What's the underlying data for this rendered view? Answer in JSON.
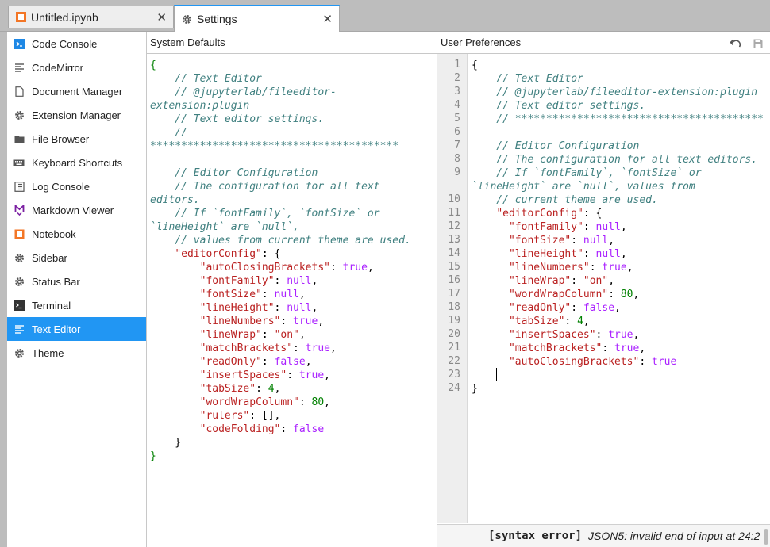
{
  "tabs": [
    {
      "label": "Untitled.ipynb",
      "icon": "notebook-icon",
      "active": false
    },
    {
      "label": "Settings",
      "icon": "gear-icon",
      "active": true
    }
  ],
  "close_glyph": "✕",
  "sidebar": {
    "items": [
      {
        "label": "Code Console",
        "icon": "console-icon"
      },
      {
        "label": "CodeMirror",
        "icon": "text-lines-icon"
      },
      {
        "label": "Document Manager",
        "icon": "document-icon"
      },
      {
        "label": "Extension Manager",
        "icon": "gear-icon"
      },
      {
        "label": "File Browser",
        "icon": "folder-icon"
      },
      {
        "label": "Keyboard Shortcuts",
        "icon": "keyboard-icon"
      },
      {
        "label": "Log Console",
        "icon": "list-icon"
      },
      {
        "label": "Markdown Viewer",
        "icon": "markdown-icon"
      },
      {
        "label": "Notebook",
        "icon": "notebook-icon"
      },
      {
        "label": "Sidebar",
        "icon": "gear-icon"
      },
      {
        "label": "Status Bar",
        "icon": "gear-icon"
      },
      {
        "label": "Terminal",
        "icon": "terminal-icon"
      },
      {
        "label": "Text Editor",
        "icon": "text-lines-icon",
        "active": true
      },
      {
        "label": "Theme",
        "icon": "gear-icon"
      }
    ]
  },
  "system_defaults": {
    "title": "System Defaults",
    "lines": [
      [
        [
          "g",
          "{"
        ]
      ],
      [
        [
          "c",
          "    // Text Editor"
        ]
      ],
      [
        [
          "c",
          "    // @jupyterlab/fileeditor-"
        ]
      ],
      [
        [
          "c",
          "extension:plugin"
        ]
      ],
      [
        [
          "c",
          "    // Text editor settings."
        ]
      ],
      [
        [
          "c",
          "    //"
        ]
      ],
      [
        [
          "c",
          "****************************************"
        ]
      ],
      [],
      [
        [
          "c",
          "    // Editor Configuration"
        ]
      ],
      [
        [
          "c",
          "    // The configuration for all text"
        ]
      ],
      [
        [
          "c",
          "editors."
        ]
      ],
      [
        [
          "c",
          "    // If `fontFamily`, `fontSize` or"
        ]
      ],
      [
        [
          "c",
          "`lineHeight` are `null`,"
        ]
      ],
      [
        [
          "c",
          "    // values from current theme are used."
        ]
      ],
      [
        [
          "p",
          "    "
        ],
        [
          "s",
          "\"editorConfig\""
        ],
        [
          "p",
          ": {"
        ]
      ],
      [
        [
          "p",
          "        "
        ],
        [
          "s",
          "\"autoClosingBrackets\""
        ],
        [
          "p",
          ": "
        ],
        [
          "a",
          "true"
        ],
        [
          "p",
          ","
        ]
      ],
      [
        [
          "p",
          "        "
        ],
        [
          "s",
          "\"fontFamily\""
        ],
        [
          "p",
          ": "
        ],
        [
          "a",
          "null"
        ],
        [
          "p",
          ","
        ]
      ],
      [
        [
          "p",
          "        "
        ],
        [
          "s",
          "\"fontSize\""
        ],
        [
          "p",
          ": "
        ],
        [
          "a",
          "null"
        ],
        [
          "p",
          ","
        ]
      ],
      [
        [
          "p",
          "        "
        ],
        [
          "s",
          "\"lineHeight\""
        ],
        [
          "p",
          ": "
        ],
        [
          "a",
          "null"
        ],
        [
          "p",
          ","
        ]
      ],
      [
        [
          "p",
          "        "
        ],
        [
          "s",
          "\"lineNumbers\""
        ],
        [
          "p",
          ": "
        ],
        [
          "a",
          "true"
        ],
        [
          "p",
          ","
        ]
      ],
      [
        [
          "p",
          "        "
        ],
        [
          "s",
          "\"lineWrap\""
        ],
        [
          "p",
          ": "
        ],
        [
          "s",
          "\"on\""
        ],
        [
          "p",
          ","
        ]
      ],
      [
        [
          "p",
          "        "
        ],
        [
          "s",
          "\"matchBrackets\""
        ],
        [
          "p",
          ": "
        ],
        [
          "a",
          "true"
        ],
        [
          "p",
          ","
        ]
      ],
      [
        [
          "p",
          "        "
        ],
        [
          "s",
          "\"readOnly\""
        ],
        [
          "p",
          ": "
        ],
        [
          "a",
          "false"
        ],
        [
          "p",
          ","
        ]
      ],
      [
        [
          "p",
          "        "
        ],
        [
          "s",
          "\"insertSpaces\""
        ],
        [
          "p",
          ": "
        ],
        [
          "a",
          "true"
        ],
        [
          "p",
          ","
        ]
      ],
      [
        [
          "p",
          "        "
        ],
        [
          "s",
          "\"tabSize\""
        ],
        [
          "p",
          ": "
        ],
        [
          "n",
          "4"
        ],
        [
          "p",
          ","
        ]
      ],
      [
        [
          "p",
          "        "
        ],
        [
          "s",
          "\"wordWrapColumn\""
        ],
        [
          "p",
          ": "
        ],
        [
          "n",
          "80"
        ],
        [
          "p",
          ","
        ]
      ],
      [
        [
          "p",
          "        "
        ],
        [
          "s",
          "\"rulers\""
        ],
        [
          "p",
          ": [],"
        ]
      ],
      [
        [
          "p",
          "        "
        ],
        [
          "s",
          "\"codeFolding\""
        ],
        [
          "p",
          ": "
        ],
        [
          "a",
          "false"
        ]
      ],
      [
        [
          "p",
          "    }"
        ]
      ],
      [
        [
          "g",
          "}"
        ]
      ]
    ]
  },
  "user_preferences": {
    "title": "User Preferences",
    "undo_icon": "undo-icon",
    "save_icon": "save-icon",
    "lines": [
      {
        "num": "1",
        "segs": [
          [
            "p",
            "{"
          ]
        ]
      },
      {
        "num": "2",
        "segs": [
          [
            "c",
            "    // Text Editor"
          ]
        ]
      },
      {
        "num": "3",
        "segs": [
          [
            "c",
            "    // @jupyterlab/fileeditor-extension:plugin"
          ]
        ]
      },
      {
        "num": "4",
        "segs": [
          [
            "c",
            "    // Text editor settings."
          ]
        ]
      },
      {
        "num": "5",
        "segs": [
          [
            "c",
            "    // ****************************************"
          ]
        ]
      },
      {
        "num": "6",
        "segs": []
      },
      {
        "num": "7",
        "segs": [
          [
            "c",
            "    // Editor Configuration"
          ]
        ]
      },
      {
        "num": "8",
        "segs": [
          [
            "c",
            "    // The configuration for all text editors."
          ]
        ]
      },
      {
        "num": "9",
        "segs": [
          [
            "c",
            "    // If `fontFamily`, `fontSize` or"
          ]
        ]
      },
      {
        "num": "",
        "segs": [
          [
            "c",
            "`lineHeight` are `null`, values from"
          ]
        ]
      },
      {
        "num": "10",
        "segs": [
          [
            "c",
            "    // current theme are used."
          ]
        ]
      },
      {
        "num": "11",
        "segs": [
          [
            "p",
            "    "
          ],
          [
            "s",
            "\"editorConfig\""
          ],
          [
            "p",
            ": {"
          ]
        ]
      },
      {
        "num": "12",
        "segs": [
          [
            "p",
            "      "
          ],
          [
            "s",
            "\"fontFamily\""
          ],
          [
            "p",
            ": "
          ],
          [
            "a",
            "null"
          ],
          [
            "p",
            ","
          ]
        ]
      },
      {
        "num": "13",
        "segs": [
          [
            "p",
            "      "
          ],
          [
            "s",
            "\"fontSize\""
          ],
          [
            "p",
            ": "
          ],
          [
            "a",
            "null"
          ],
          [
            "p",
            ","
          ]
        ]
      },
      {
        "num": "14",
        "segs": [
          [
            "p",
            "      "
          ],
          [
            "s",
            "\"lineHeight\""
          ],
          [
            "p",
            ": "
          ],
          [
            "a",
            "null"
          ],
          [
            "p",
            ","
          ]
        ]
      },
      {
        "num": "15",
        "segs": [
          [
            "p",
            "      "
          ],
          [
            "s",
            "\"lineNumbers\""
          ],
          [
            "p",
            ": "
          ],
          [
            "a",
            "true"
          ],
          [
            "p",
            ","
          ]
        ]
      },
      {
        "num": "16",
        "segs": [
          [
            "p",
            "      "
          ],
          [
            "s",
            "\"lineWrap\""
          ],
          [
            "p",
            ": "
          ],
          [
            "s",
            "\"on\""
          ],
          [
            "p",
            ","
          ]
        ]
      },
      {
        "num": "17",
        "segs": [
          [
            "p",
            "      "
          ],
          [
            "s",
            "\"wordWrapColumn\""
          ],
          [
            "p",
            ": "
          ],
          [
            "n",
            "80"
          ],
          [
            "p",
            ","
          ]
        ]
      },
      {
        "num": "18",
        "segs": [
          [
            "p",
            "      "
          ],
          [
            "s",
            "\"readOnly\""
          ],
          [
            "p",
            ": "
          ],
          [
            "a",
            "false"
          ],
          [
            "p",
            ","
          ]
        ]
      },
      {
        "num": "19",
        "segs": [
          [
            "p",
            "      "
          ],
          [
            "s",
            "\"tabSize\""
          ],
          [
            "p",
            ": "
          ],
          [
            "n",
            "4"
          ],
          [
            "p",
            ","
          ]
        ]
      },
      {
        "num": "20",
        "segs": [
          [
            "p",
            "      "
          ],
          [
            "s",
            "\"insertSpaces\""
          ],
          [
            "p",
            ": "
          ],
          [
            "a",
            "true"
          ],
          [
            "p",
            ","
          ]
        ]
      },
      {
        "num": "21",
        "segs": [
          [
            "p",
            "      "
          ],
          [
            "s",
            "\"matchBrackets\""
          ],
          [
            "p",
            ": "
          ],
          [
            "a",
            "true"
          ],
          [
            "p",
            ","
          ]
        ]
      },
      {
        "num": "22",
        "segs": [
          [
            "p",
            "      "
          ],
          [
            "s",
            "\"autoClosingBrackets\""
          ],
          [
            "p",
            ": "
          ],
          [
            "a",
            "true"
          ]
        ]
      },
      {
        "num": "23",
        "segs": []
      },
      {
        "num": "24",
        "segs": [
          [
            "p",
            "}"
          ]
        ]
      }
    ]
  },
  "status": {
    "error_label": "[syntax error]",
    "error_message": "JSON5: invalid end of input at 24:2"
  },
  "colors": {
    "accent": "#2196f3",
    "comment": "#408080",
    "string": "#ba2121",
    "atom": "#aa22ff",
    "number": "#008000"
  }
}
